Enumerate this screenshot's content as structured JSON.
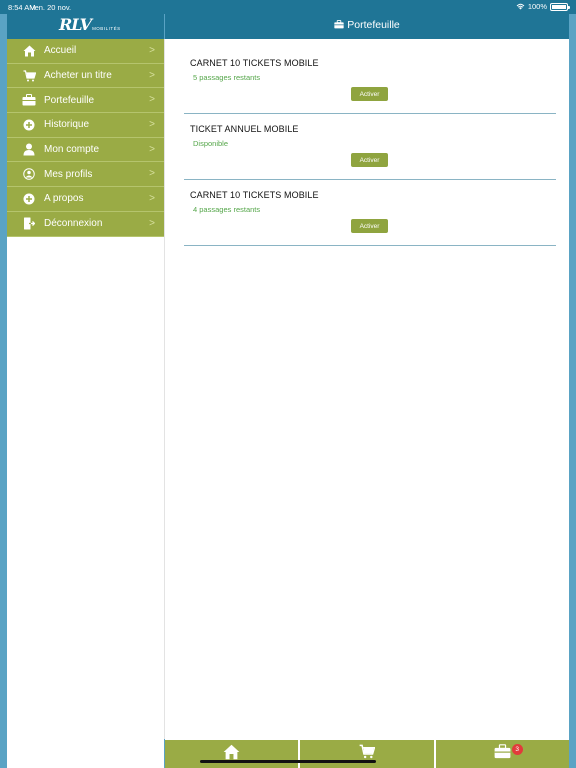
{
  "status": {
    "time": "8:54 AM",
    "date": "Ven. 20 nov.",
    "battery": "100%"
  },
  "brand": {
    "logo_main": "RLV",
    "logo_sub": "MOBILITÉS"
  },
  "header": {
    "title": "Portefeuille"
  },
  "menu": [
    {
      "label": "Accueil",
      "icon": "home-icon"
    },
    {
      "label": "Acheter un titre",
      "icon": "cart-icon"
    },
    {
      "label": "Portefeuille",
      "icon": "briefcase-icon"
    },
    {
      "label": "Historique",
      "icon": "plus-circle-icon"
    },
    {
      "label": "Mon compte",
      "icon": "user-icon"
    },
    {
      "label": "Mes profils",
      "icon": "user-circle-icon"
    },
    {
      "label": "A propos",
      "icon": "plus-circle-icon"
    },
    {
      "label": "Déconnexion",
      "icon": "logout-icon"
    }
  ],
  "tickets": [
    {
      "name": "CARNET 10 TICKETS MOBILE",
      "status": "5 passages restants",
      "action": "Activer"
    },
    {
      "name": "TICKET ANNUEL MOBILE",
      "status": "Disponible",
      "action": "Activer"
    },
    {
      "name": "CARNET 10 TICKETS MOBILE",
      "status": "4 passages restants",
      "action": "Activer"
    }
  ],
  "tabbar": {
    "wallet_badge": "3"
  },
  "colors": {
    "accent_blue": "#1f7596",
    "olive": "#9aab45",
    "status_green": "#55a64a",
    "badge_red": "#e23b3b"
  }
}
